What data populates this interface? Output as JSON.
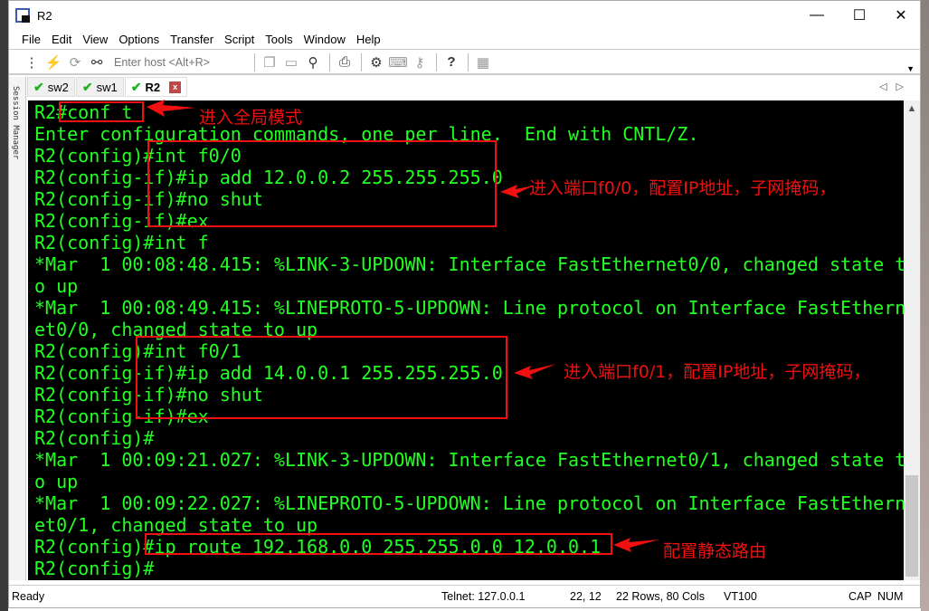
{
  "window": {
    "title": "R2",
    "minimize": "—",
    "maximize": "☐",
    "close": "✕"
  },
  "menu": [
    "File",
    "Edit",
    "View",
    "Options",
    "Transfer",
    "Script",
    "Tools",
    "Window",
    "Help"
  ],
  "toolbar": {
    "host_placeholder": "Enter host <Alt+R>"
  },
  "tabs": [
    {
      "label": "sw2",
      "active": false
    },
    {
      "label": "sw1",
      "active": false
    },
    {
      "label": "R2",
      "active": true
    }
  ],
  "tab_close": "x",
  "session_manager": "Session Manager",
  "terminal": {
    "lines": [
      "R2#conf t",
      "Enter configuration commands, one per line.  End with CNTL/Z.",
      "R2(config)#int f0/0",
      "R2(config-if)#ip add 12.0.0.2 255.255.255.0",
      "R2(config-if)#no shut",
      "R2(config-if)#ex",
      "R2(config)#int f",
      "*Mar  1 00:08:48.415: %LINK-3-UPDOWN: Interface FastEthernet0/0, changed state t",
      "o up",
      "*Mar  1 00:08:49.415: %LINEPROTO-5-UPDOWN: Line protocol on Interface FastEthern",
      "et0/0, changed state to up",
      "R2(config)#int f0/1",
      "R2(config-if)#ip add 14.0.0.1 255.255.255.0",
      "R2(config-if)#no shut",
      "R2(config-if)#ex",
      "R2(config)#",
      "*Mar  1 00:09:21.027: %LINK-3-UPDOWN: Interface FastEthernet0/1, changed state t",
      "o up",
      "*Mar  1 00:09:22.027: %LINEPROTO-5-UPDOWN: Line protocol on Interface FastEthern",
      "et0/1, changed state to up",
      "R2(config)#ip route 192.168.0.0 255.255.0.0 12.0.0.1",
      "R2(config)#"
    ],
    "text_color": "#22ff22",
    "background": "#000000"
  },
  "annotations": {
    "global_mode": "进入全局模式",
    "f00": "进入端口f0/0，配置IP地址，子网掩码，",
    "f01": "进入端口f0/1，配置IP地址，子网掩码，",
    "static_route": "配置静态路由",
    "color": "#f01010"
  },
  "status": {
    "ready": "Ready",
    "connection": "Telnet: 127.0.0.1",
    "cursor": "22,  12",
    "size": "22 Rows, 80 Cols",
    "emulation": "VT100",
    "caps": "CAP",
    "num": "NUM"
  }
}
